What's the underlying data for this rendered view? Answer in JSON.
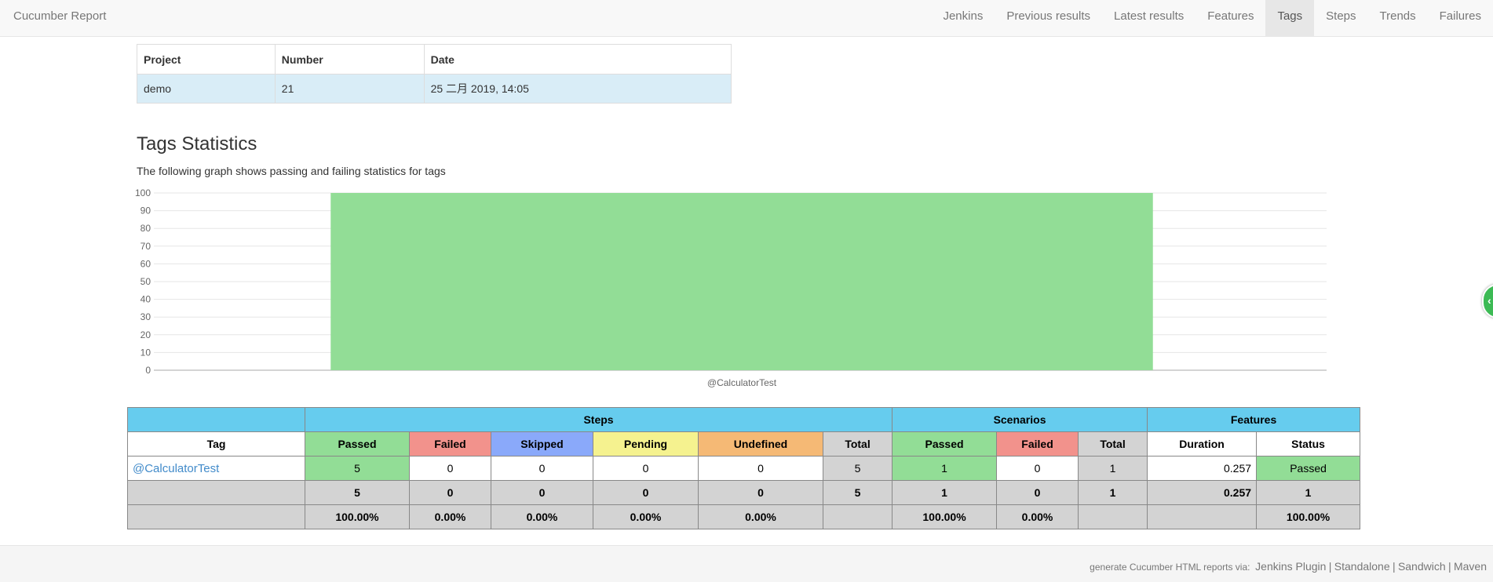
{
  "navbar": {
    "brand": "Cucumber Report",
    "items": [
      {
        "label": "Jenkins"
      },
      {
        "label": "Previous results"
      },
      {
        "label": "Latest results"
      },
      {
        "label": "Features"
      },
      {
        "label": "Tags",
        "active": true
      },
      {
        "label": "Steps"
      },
      {
        "label": "Trends"
      },
      {
        "label": "Failures"
      }
    ]
  },
  "build": {
    "headers": {
      "project": "Project",
      "number": "Number",
      "date": "Date"
    },
    "row": {
      "project": "demo",
      "number": "21",
      "date": "25 二月 2019, 14:05"
    }
  },
  "page": {
    "title": "Tags Statistics",
    "description": "The following graph shows passing and failing statistics for tags"
  },
  "chart_data": {
    "type": "bar",
    "categories": [
      "@CalculatorTest"
    ],
    "series": [
      {
        "values": [
          100
        ],
        "color": "#92dd96"
      }
    ],
    "ylim": [
      0,
      100
    ],
    "yticks": [
      "100",
      "90",
      "80",
      "70",
      "60",
      "50",
      "40",
      "30",
      "20",
      "10",
      "0"
    ],
    "grid": true
  },
  "stats": {
    "groups": {
      "steps": "Steps",
      "scenarios": "Scenarios",
      "features": "Features"
    },
    "columns": {
      "tag": "Tag",
      "passed": "Passed",
      "failed": "Failed",
      "skipped": "Skipped",
      "pending": "Pending",
      "undefined": "Undefined",
      "total": "Total",
      "sc_passed": "Passed",
      "sc_failed": "Failed",
      "sc_total": "Total",
      "duration": "Duration",
      "status": "Status"
    },
    "row": {
      "tag": "@CalculatorTest",
      "passed": "5",
      "failed": "0",
      "skipped": "0",
      "pending": "0",
      "undefined": "0",
      "total": "5",
      "sc_passed": "1",
      "sc_failed": "0",
      "sc_total": "1",
      "duration": "0.257",
      "status": "Passed"
    },
    "totals": {
      "passed": "5",
      "failed": "0",
      "skipped": "0",
      "pending": "0",
      "undefined": "0",
      "total": "5",
      "sc_passed": "1",
      "sc_failed": "0",
      "sc_total": "1",
      "duration": "0.257",
      "status": "1"
    },
    "percent": {
      "passed": "100.00%",
      "failed": "0.00%",
      "skipped": "0.00%",
      "pending": "0.00%",
      "undefined": "0.00%",
      "sc_passed": "100.00%",
      "sc_failed": "0.00%",
      "status": "100.00%"
    }
  },
  "footer": {
    "prefix": "generate Cucumber HTML reports via:",
    "links": [
      "Jenkins Plugin",
      "Standalone",
      "Sandwich",
      "Maven"
    ],
    "separator": "|"
  },
  "colors": {
    "passed": "#92dd96",
    "failed": "#f2928c",
    "skipped": "#8aa9fa",
    "pending": "#f5f28f",
    "undefined": "#f5b975",
    "total": "#d3d3d3",
    "group_header": "#66ccee",
    "link": "#428bca"
  }
}
